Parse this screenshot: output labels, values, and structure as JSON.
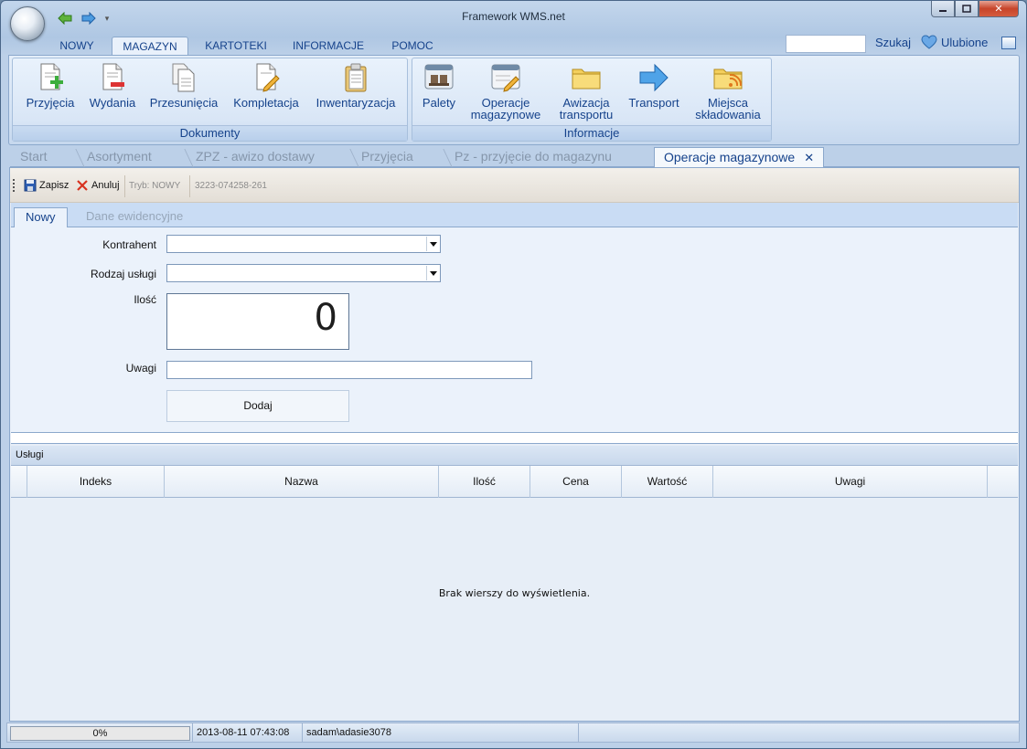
{
  "window": {
    "title": "Framework WMS.net"
  },
  "ribbon_tabs": [
    "NOWY",
    "MAGAZYN",
    "KARTOTEKI",
    "INFORMACJE",
    "POMOC"
  ],
  "search": {
    "label": "Szukaj",
    "value": ""
  },
  "favorites_label": "Ulubione",
  "groups": {
    "dokumenty": {
      "label": "Dokumenty",
      "buttons": [
        "Przyjęcia",
        "Wydania",
        "Przesunięcia",
        "Kompletacja",
        "Inwentaryzacja"
      ]
    },
    "informacje": {
      "label": "Informacje",
      "buttons": [
        {
          "line1": "Palety",
          "line2": ""
        },
        {
          "line1": "Operacje",
          "line2": "magazynowe"
        },
        {
          "line1": "Awizacja",
          "line2": "transportu"
        },
        {
          "line1": "Transport",
          "line2": ""
        },
        {
          "line1": "Miejsca",
          "line2": "składowania"
        }
      ]
    }
  },
  "doc_tabs": [
    "Start",
    "Asortyment",
    "ZPZ - awizo dostawy",
    "Przyjęcia",
    "Pz - przyjęcie do magazynu",
    "Operacje magazynowe"
  ],
  "toolbar": {
    "save": "Zapisz",
    "cancel": "Anuluj",
    "mode": "Tryb: NOWY",
    "doc_number": "3223-074258-261"
  },
  "form_tabs": [
    "Nowy",
    "Dane ewidencyjne"
  ],
  "form": {
    "contractor_label": "Kontrahent",
    "service_type_label": "Rodzaj usługi",
    "quantity_label": "Ilość",
    "quantity_value": "0",
    "notes_label": "Uwagi",
    "add_button": "Dodaj"
  },
  "grid": {
    "caption": "Usługi",
    "columns": [
      "Indeks",
      "Nazwa",
      "Ilość",
      "Cena",
      "Wartość",
      "Uwagi"
    ],
    "empty_message": "Brak wierszy do wyświetlenia."
  },
  "status": {
    "progress_percent": 0,
    "progress_text": "0%",
    "datetime": "2013-08-11 07:43:08",
    "user": "sadam\\adasie3078"
  },
  "colors": {
    "accent": "#15428b",
    "ribbon_bg": "#dbe7f6",
    "progress": "#5fae4a"
  }
}
